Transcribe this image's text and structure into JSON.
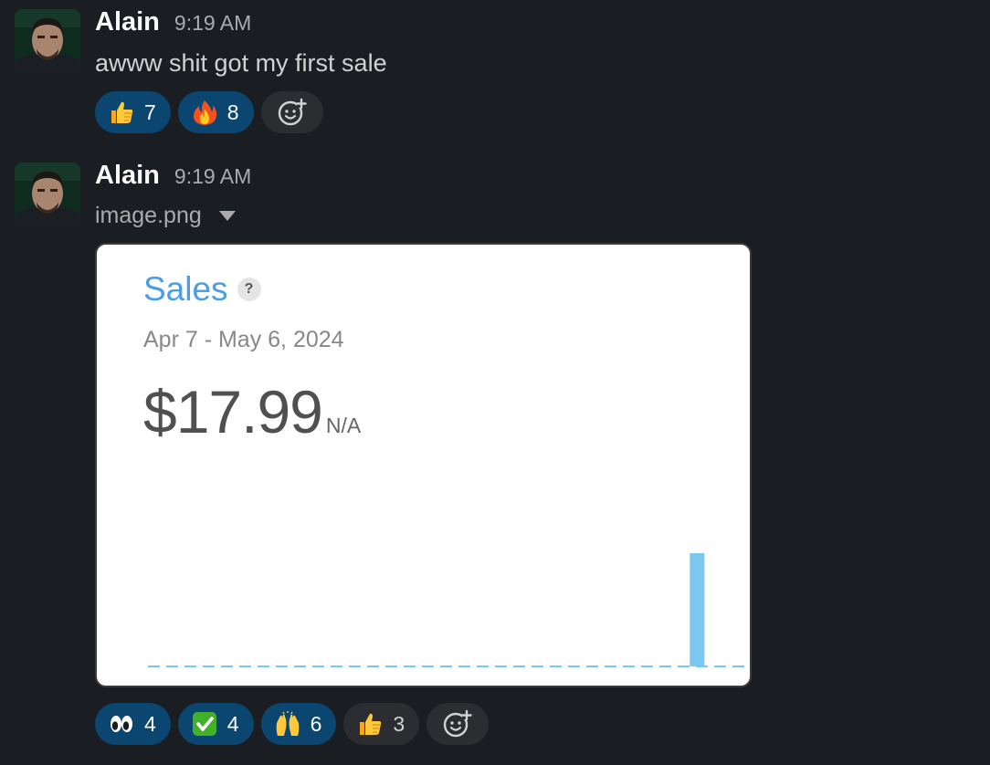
{
  "messages": [
    {
      "author": "Alain",
      "time": "9:19 AM",
      "text": "awww shit got my first sale",
      "reactions": [
        {
          "emoji": "thumbs-up",
          "count": "7",
          "selected": true
        },
        {
          "emoji": "fire",
          "count": "8",
          "selected": true
        }
      ]
    },
    {
      "author": "Alain",
      "time": "9:19 AM",
      "filename": "image.png",
      "reactions": [
        {
          "emoji": "eyes",
          "count": "4",
          "selected": true
        },
        {
          "emoji": "check-mark",
          "count": "4",
          "selected": true
        },
        {
          "emoji": "raising-hands",
          "count": "6",
          "selected": true
        },
        {
          "emoji": "thumbs-up",
          "count": "3",
          "selected": false
        }
      ]
    }
  ],
  "attachment": {
    "title": "Sales",
    "help_icon": "?",
    "date_range": "Apr 7 - May 6, 2024",
    "value": "$17.99",
    "change": "N/A"
  },
  "chart_data": {
    "type": "bar",
    "title": "Sales",
    "x_range": [
      "Apr 7, 2024",
      "May 6, 2024"
    ],
    "values": [
      0,
      0,
      0,
      0,
      0,
      0,
      0,
      0,
      0,
      0,
      0,
      0,
      0,
      0,
      0,
      0,
      0,
      0,
      0,
      0,
      0,
      0,
      0,
      0,
      0,
      0,
      0,
      17.99,
      0,
      0
    ],
    "bar_color": "#7cc7f0",
    "baseline_style": "dashed"
  },
  "colors": {
    "background": "#1a1d21",
    "reaction_selected": "#0b4670",
    "reaction_unselected": "#2c2d30",
    "chart_title": "#4a9ee8"
  }
}
